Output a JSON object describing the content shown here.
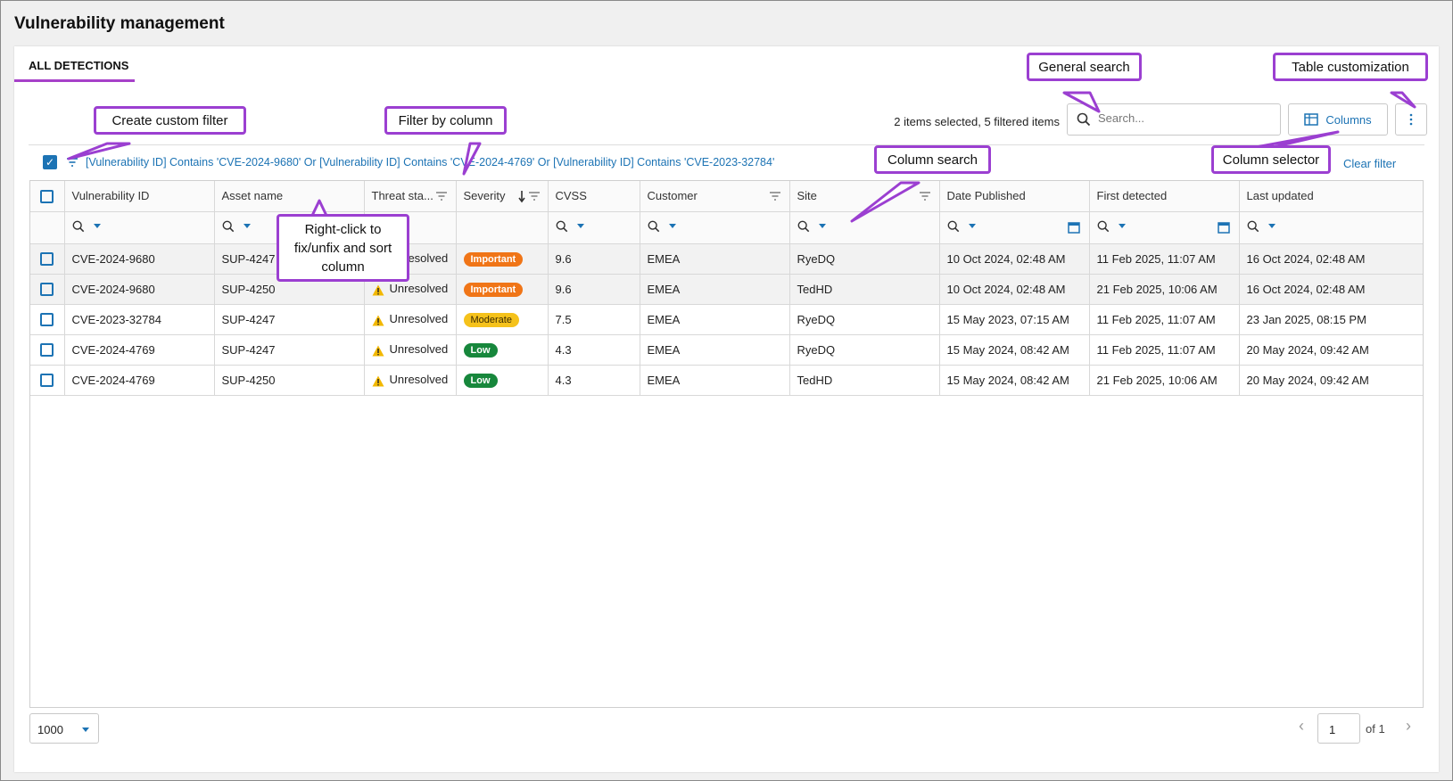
{
  "page": {
    "title": "Vulnerability management"
  },
  "tabs": [
    {
      "label": "ALL DETECTIONS",
      "active": true
    }
  ],
  "toolbar": {
    "selection_info": "2 items selected, 5 filtered items",
    "search_placeholder": "Search...",
    "columns_label": "Columns",
    "more_icon": "vertical-ellipsis-icon"
  },
  "filter_bar": {
    "expression": "[Vulnerability ID] Contains 'CVE-2024-9680' Or [Vulnerability ID] Contains 'CVE-2024-4769' Or [Vulnerability ID] Contains 'CVE-2023-32784'",
    "clear_label": "Clear filter",
    "checked": true
  },
  "table": {
    "columns": [
      "Vulnerability ID",
      "Asset name",
      "Threat sta...",
      "Severity",
      "CVSS",
      "Customer",
      "Site",
      "Date Published",
      "First detected",
      "Last updated"
    ],
    "rows": [
      {
        "vuln_id": "CVE-2024-9680",
        "asset": "SUP-4247",
        "threat": "Unresolved",
        "severity": "Important",
        "cvss": "9.6",
        "customer": "EMEA",
        "site": "RyeDQ",
        "published": "10 Oct 2024, 02:48 AM",
        "first": "11 Feb 2025, 11:07 AM",
        "last": "16 Oct 2024, 02:48 AM"
      },
      {
        "vuln_id": "CVE-2024-9680",
        "asset": "SUP-4250",
        "threat": "Unresolved",
        "severity": "Important",
        "cvss": "9.6",
        "customer": "EMEA",
        "site": "TedHD",
        "published": "10 Oct 2024, 02:48 AM",
        "first": "21 Feb 2025, 10:06 AM",
        "last": "16 Oct 2024, 02:48 AM"
      },
      {
        "vuln_id": "CVE-2023-32784",
        "asset": "SUP-4247",
        "threat": "Unresolved",
        "severity": "Moderate",
        "cvss": "7.5",
        "customer": "EMEA",
        "site": "RyeDQ",
        "published": "15 May 2023, 07:15 AM",
        "first": "11 Feb 2025, 11:07 AM",
        "last": "23 Jan 2025, 08:15 PM"
      },
      {
        "vuln_id": "CVE-2024-4769",
        "asset": "SUP-4247",
        "threat": "Unresolved",
        "severity": "Low",
        "cvss": "4.3",
        "customer": "EMEA",
        "site": "RyeDQ",
        "published": "15 May 2024, 08:42 AM",
        "first": "11 Feb 2025, 11:07 AM",
        "last": "20 May 2024, 09:42 AM"
      },
      {
        "vuln_id": "CVE-2024-4769",
        "asset": "SUP-4250",
        "threat": "Unresolved",
        "severity": "Low",
        "cvss": "4.3",
        "customer": "EMEA",
        "site": "TedHD",
        "published": "15 May 2024, 08:42 AM",
        "first": "21 Feb 2025, 10:06 AM",
        "last": "20 May 2024, 09:42 AM"
      }
    ]
  },
  "severity_colors": {
    "Important": "#f07517",
    "Moderate": "#f5c21b",
    "Low": "#17873c"
  },
  "accent_color": "#1c73b4",
  "callout_color": "#9b3fd1",
  "pager": {
    "page_size": "1000",
    "current_page": "1",
    "of_label": "of 1"
  },
  "callouts": {
    "general_search": "General search",
    "table_customization": "Table customization",
    "create_custom_filter": "Create custom filter",
    "filter_by_column": "Filter by column",
    "column_search": "Column search",
    "column_selector": "Column selector",
    "right_click": "Right-click to fix/unfix and sort column"
  }
}
